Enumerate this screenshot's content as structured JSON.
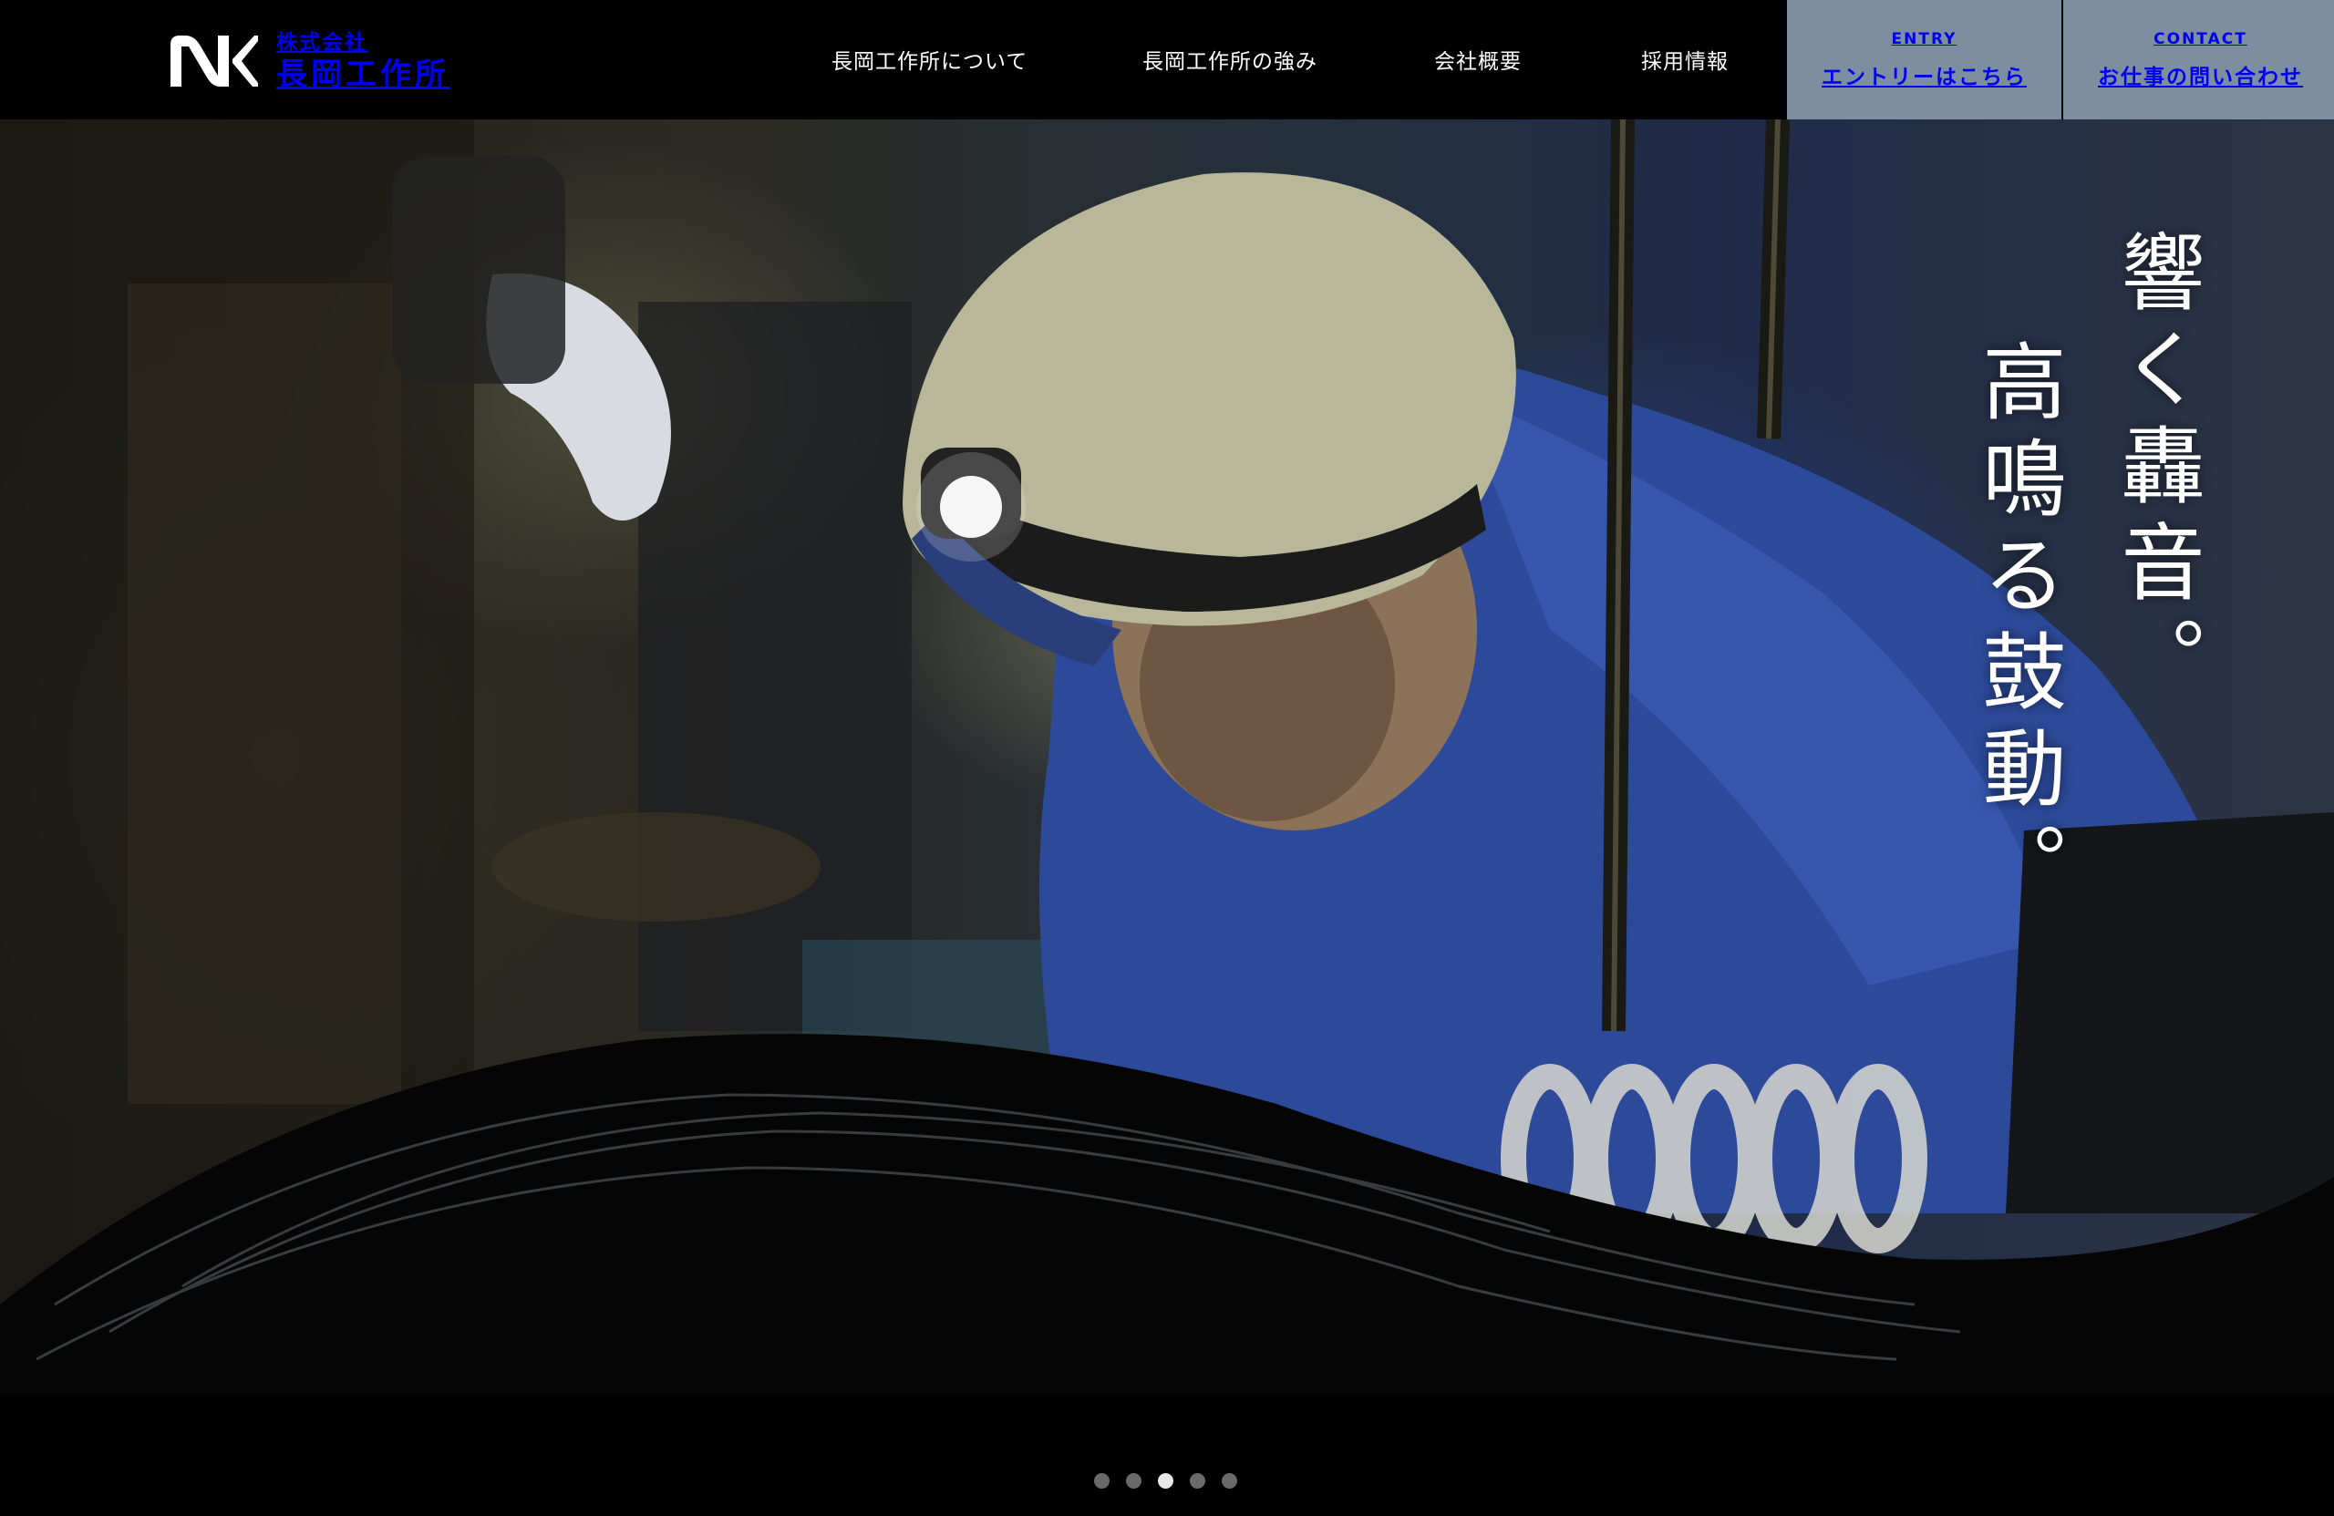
{
  "header": {
    "logo_sub": "株式会社",
    "logo_main": "長岡工作所",
    "nav": [
      {
        "label": "長岡工作所について"
      },
      {
        "label": "長岡工作所の強み"
      },
      {
        "label": "会社概要"
      },
      {
        "label": "採用情報"
      }
    ],
    "entry": {
      "en": "ENTRY",
      "ja": "エントリーはこちら"
    },
    "contact": {
      "en": "CONTACT",
      "ja": "お仕事の問い合わせ"
    }
  },
  "hero": {
    "tagline_line1": "響く轟音。",
    "tagline_line2": "高鳴る鼓動。"
  },
  "slider": {
    "count": 5,
    "active_index": 2
  },
  "colors": {
    "cta_bg": "#7d8ea0",
    "header_bg": "#000000"
  }
}
